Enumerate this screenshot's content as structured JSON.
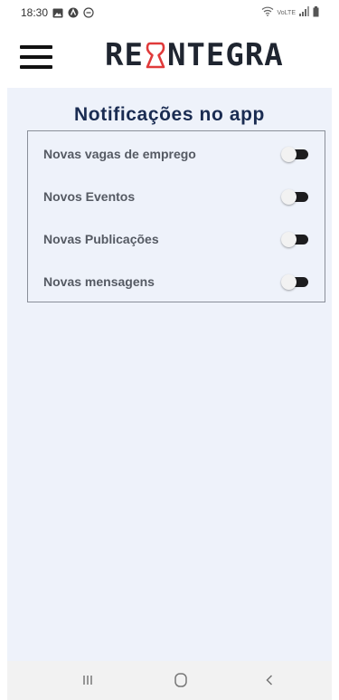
{
  "status_bar": {
    "time": "18:30",
    "left_icons": [
      "gallery-icon",
      "assistant-icon",
      "do-not-disturb-icon"
    ],
    "network_label": "VoLTE",
    "right_icons": [
      "wifi-icon",
      "signal-icon",
      "battery-icon"
    ]
  },
  "header": {
    "logo_left": "RE",
    "logo_right": "NTEGRA",
    "logo_mark_color": "#e03a3a"
  },
  "main": {
    "title": "Notificações no app",
    "settings": [
      {
        "label": "Novas vagas de emprego",
        "enabled": false
      },
      {
        "label": "Novos Eventos",
        "enabled": false
      },
      {
        "label": "Novas Publicações",
        "enabled": false
      },
      {
        "label": "Novas mensagens",
        "enabled": false
      }
    ]
  },
  "nav_bar": {
    "buttons": [
      "recent-apps-icon",
      "home-icon",
      "back-icon"
    ]
  },
  "colors": {
    "title": "#1a2c52",
    "content_bg": "#eef2fa",
    "toggle_track_off": "#1d1d1f"
  }
}
